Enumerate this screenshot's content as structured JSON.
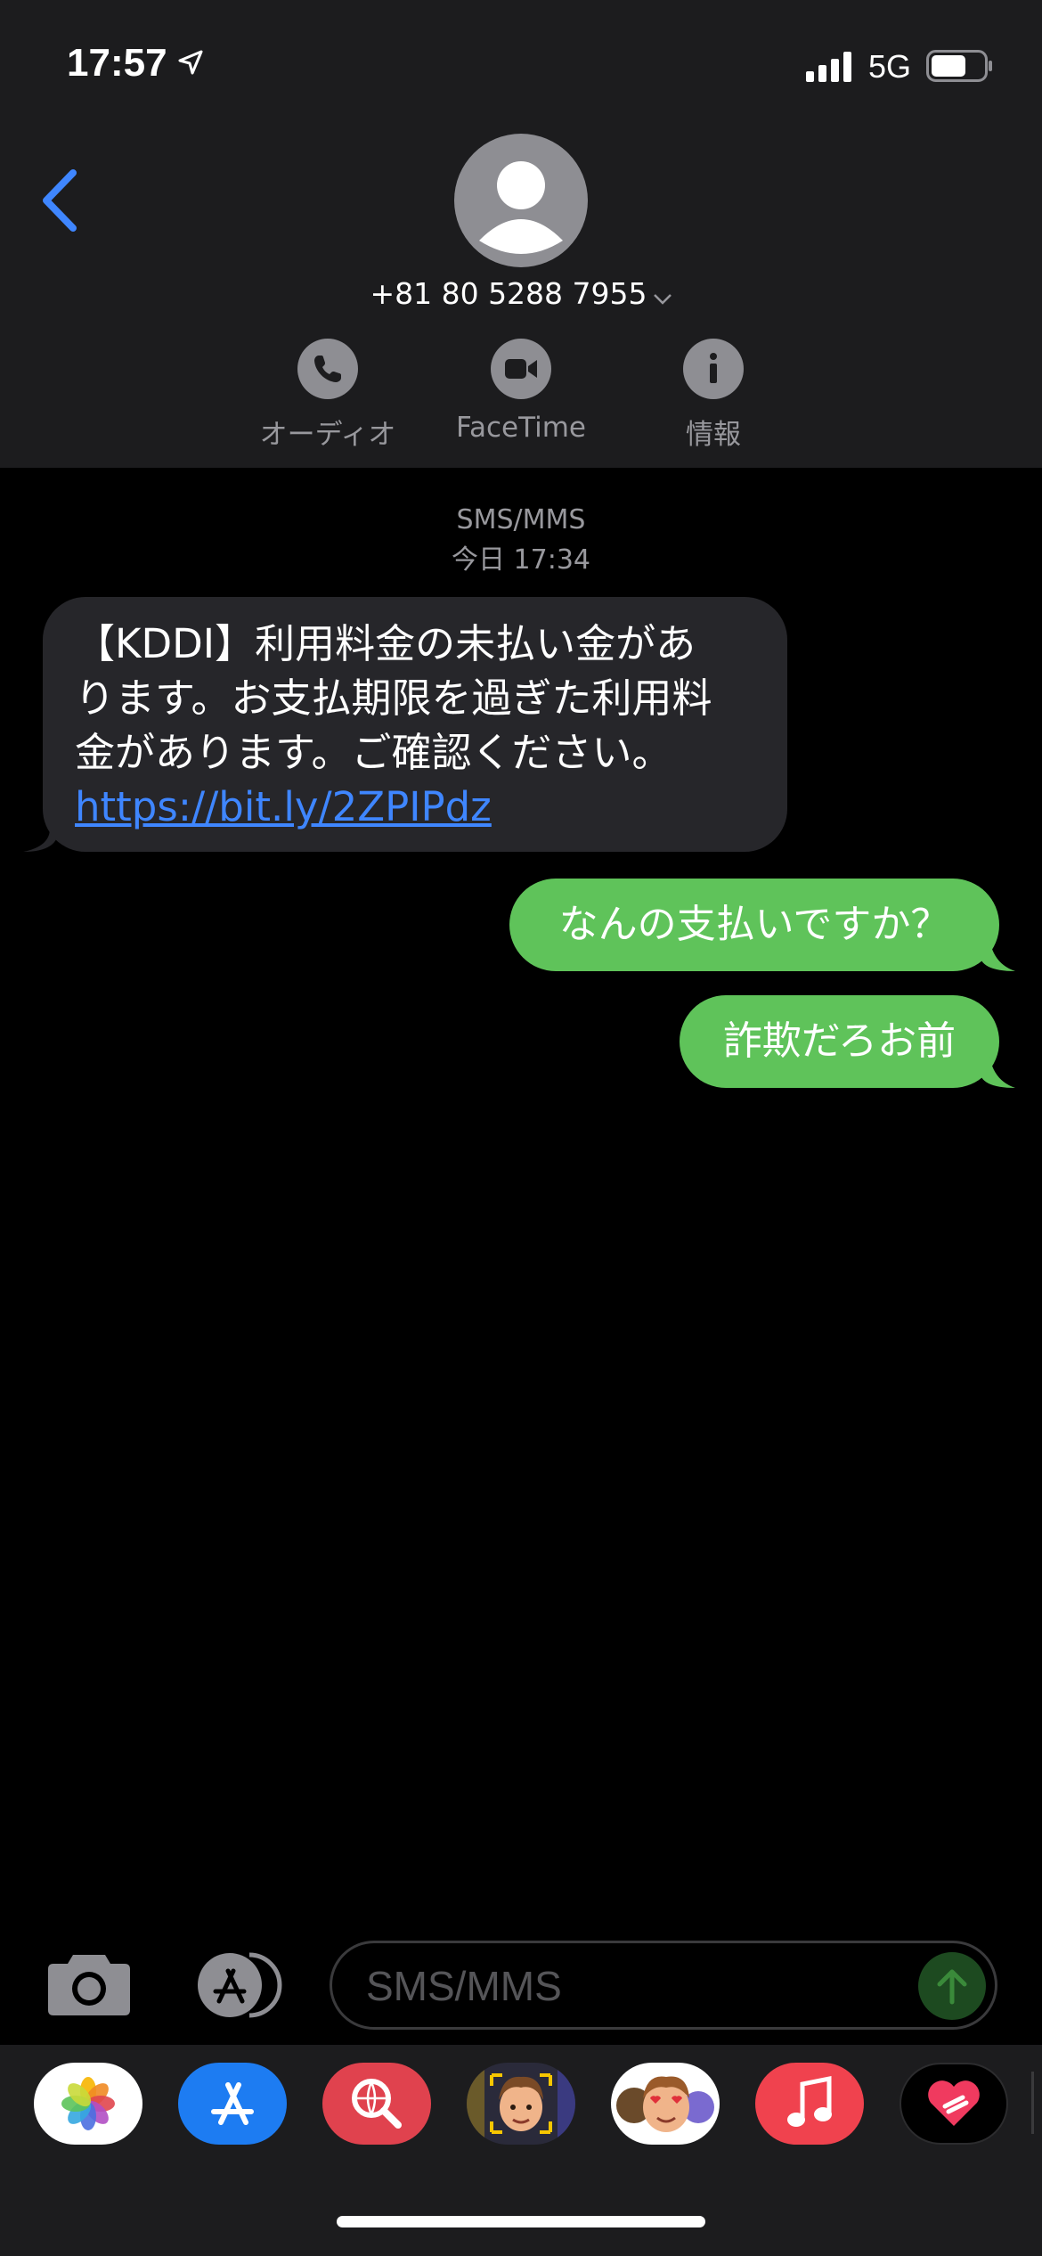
{
  "status_bar": {
    "time": "17:57",
    "network": "5G"
  },
  "contact": {
    "name": "+81 80 5288 7955"
  },
  "actions": [
    {
      "label": "オーディオ",
      "icon": "phone-icon"
    },
    {
      "label": "FaceTime",
      "icon": "video-icon"
    },
    {
      "label": "情報",
      "icon": "info-icon"
    }
  ],
  "thread": {
    "service": "SMS/MMS",
    "date": "今日 17:34",
    "messages": [
      {
        "direction": "incoming",
        "lines": [
          "【KDDI】利用料金の未払い金があ",
          "ります。お支払期限を過ぎた利用料",
          "金があります。ご確認ください。"
        ],
        "link": "https://bit.ly/2ZPIPdz"
      },
      {
        "direction": "outgoing",
        "text": "なんの支払いですか？"
      },
      {
        "direction": "outgoing",
        "text": "詐欺だろお前"
      }
    ]
  },
  "compose": {
    "placeholder": "SMS/MMS"
  },
  "app_drawer": [
    "photos-icon",
    "app-store-icon",
    "web-search-icon",
    "memoji-icon",
    "animoji-icon",
    "music-icon",
    "fitness-icon"
  ],
  "colors": {
    "accent": "#3f86ff",
    "outgoing_bubble": "#5fc35a",
    "incoming_bubble": "#26262a",
    "header_bg": "#1c1c1e"
  }
}
